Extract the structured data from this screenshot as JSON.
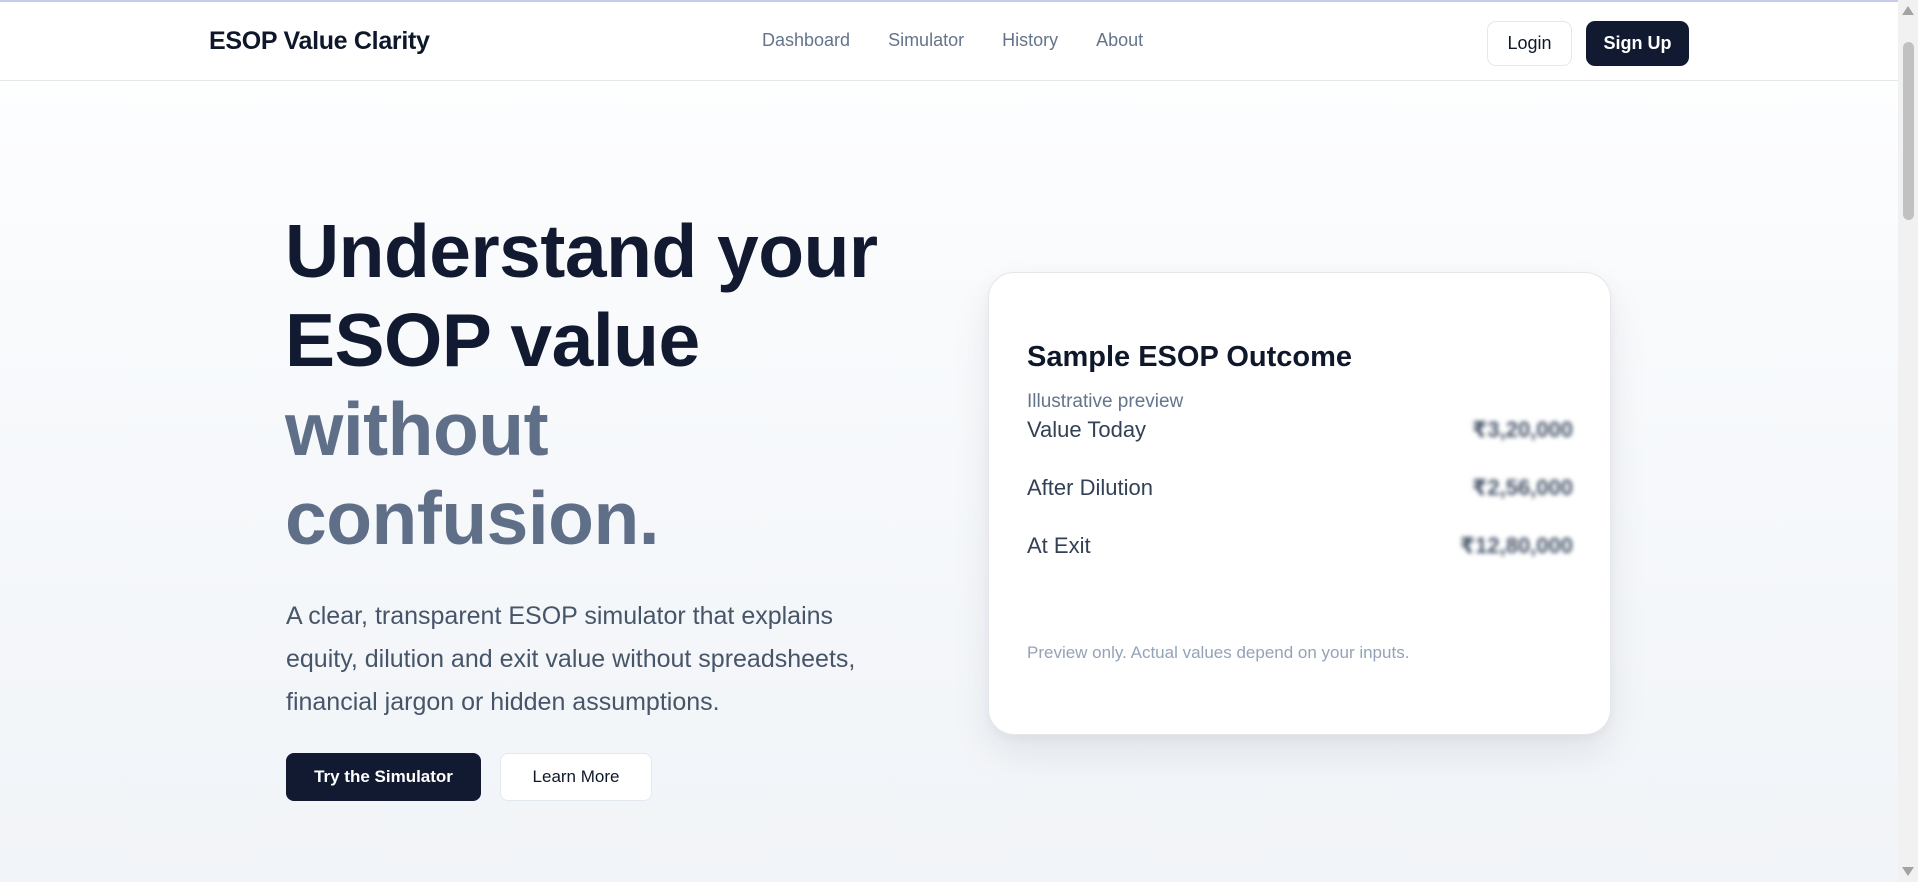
{
  "header": {
    "brand": "ESOP Value Clarity",
    "nav": [
      "Dashboard",
      "Simulator",
      "History",
      "About"
    ],
    "login_label": "Login",
    "signup_label": "Sign Up"
  },
  "hero": {
    "title_lines_dark": [
      "Understand your",
      "ESOP value"
    ],
    "title_lines_muted": [
      "without",
      "confusion."
    ],
    "description": "A clear, transparent ESOP simulator that explains equity, dilution and exit value without spreadsheets, financial jargon or hidden assumptions.",
    "primary_cta": "Try the Simulator",
    "secondary_cta": "Learn More"
  },
  "card": {
    "title": "Sample ESOP Outcome",
    "subtitle": "Illustrative preview",
    "rows": [
      {
        "label": "Value Today",
        "value": "₹3,20,000"
      },
      {
        "label": "After Dilution",
        "value": "₹2,56,000"
      },
      {
        "label": "At Exit",
        "value": "₹12,80,000"
      }
    ],
    "note": "Preview only. Actual values depend on your inputs."
  },
  "colors": {
    "primary": "#111a30",
    "muted_heading": "#5f6f88",
    "body_text": "#475569"
  }
}
